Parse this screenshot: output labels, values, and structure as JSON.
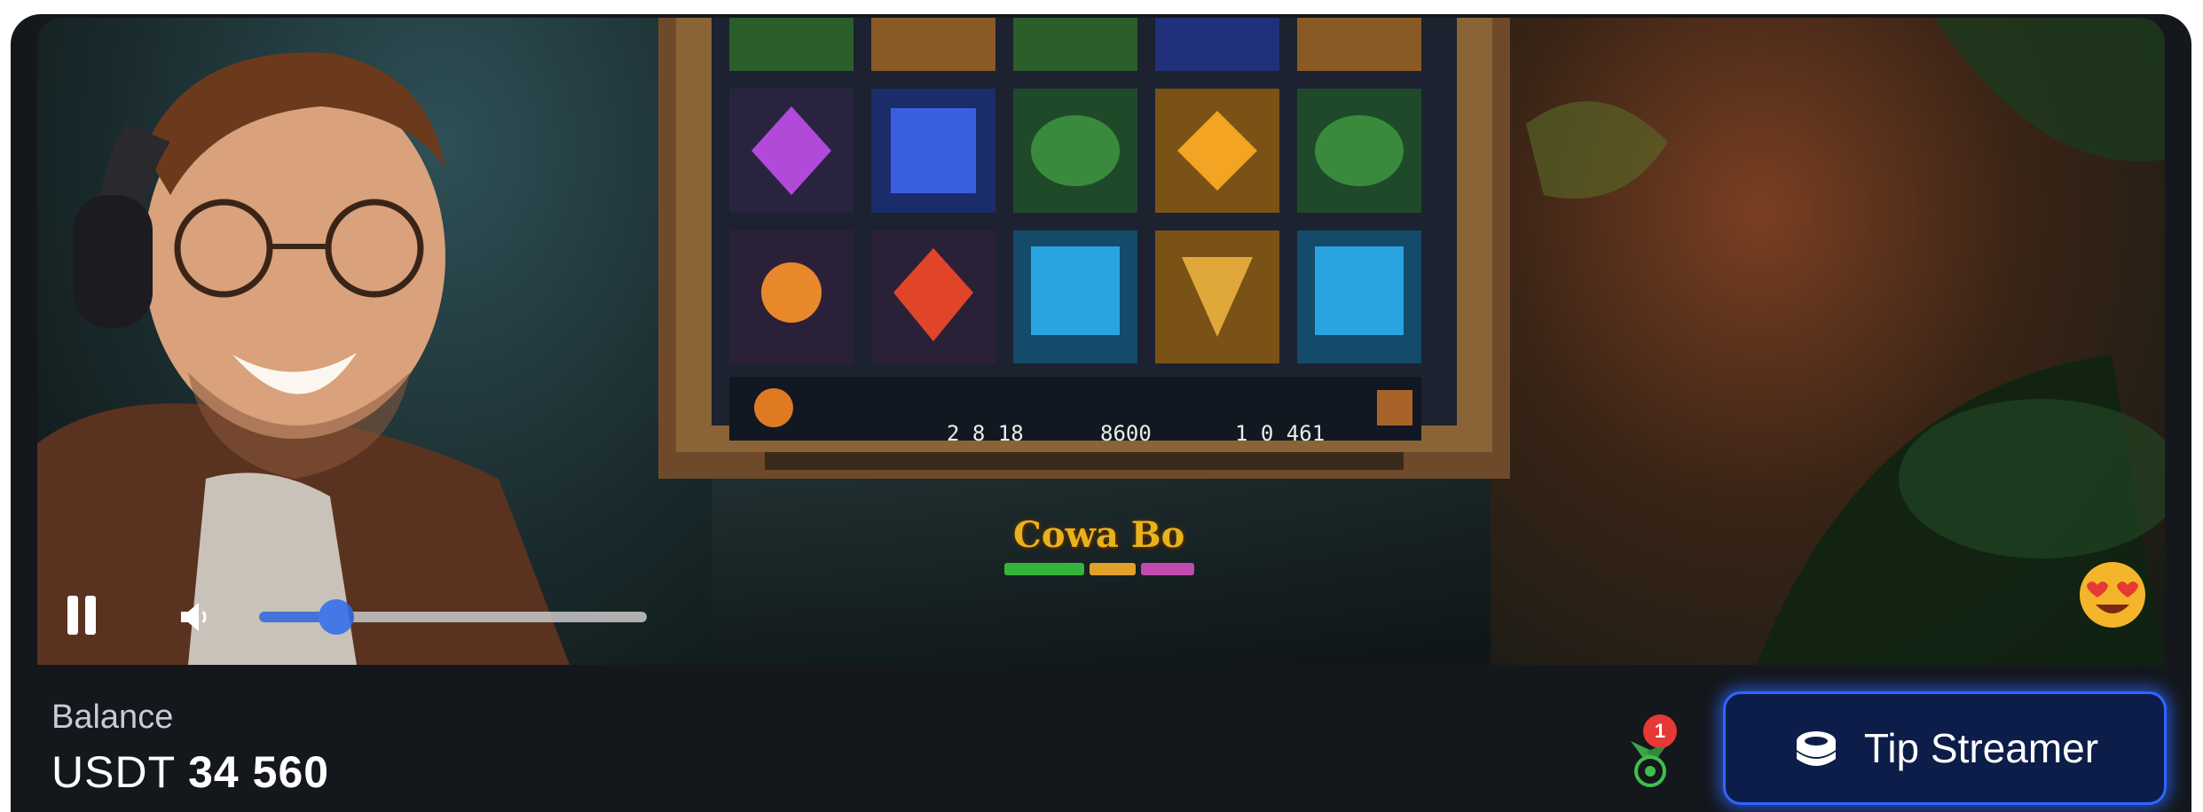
{
  "stream": {
    "game_logo": "Cowa Bo",
    "slot_panel": {
      "cells": [
        {
          "icon": "coin-icon",
          "caption": "2 8 18"
        },
        {
          "icon": "multiplier-icon",
          "caption": "8600"
        },
        {
          "icon": "win-icon",
          "caption": "1 0 461"
        }
      ]
    },
    "controls": {
      "volume_level": 0.2
    },
    "reaction_icon": "heart-eyes-emoji"
  },
  "footer": {
    "balance_label": "Balance",
    "balance_currency": "USDT",
    "balance_amount": "34 560",
    "notification_count": "1",
    "tip_button_label": "Tip Streamer"
  },
  "colors": {
    "accent": "#2e66ff",
    "card_bg": "#14171c",
    "button_bg": "#0d1d4a",
    "badge": "#e53935"
  }
}
